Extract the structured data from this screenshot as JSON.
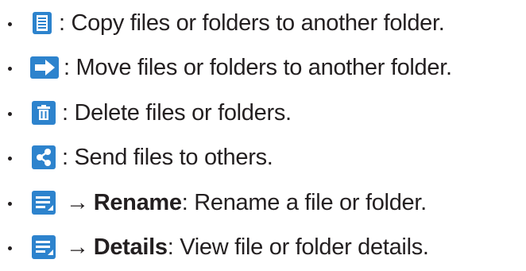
{
  "items": [
    {
      "icon": "copy-icon",
      "text": ": Copy files or folders to another folder."
    },
    {
      "icon": "move-icon",
      "text": ": Move files or folders to another folder."
    },
    {
      "icon": "delete-icon",
      "text": ": Delete files or folders."
    },
    {
      "icon": "share-icon",
      "text": ": Send files to others."
    },
    {
      "icon": "menu-icon",
      "arrow": "→",
      "bold": "Rename",
      "text": ": Rename a file or folder."
    },
    {
      "icon": "menu-icon",
      "arrow": "→",
      "bold": "Details",
      "text": ": View file or folder details."
    }
  ],
  "colors": {
    "icon_blue": "#2d83cd",
    "icon_light": "#ffffff",
    "text": "#231f20"
  }
}
